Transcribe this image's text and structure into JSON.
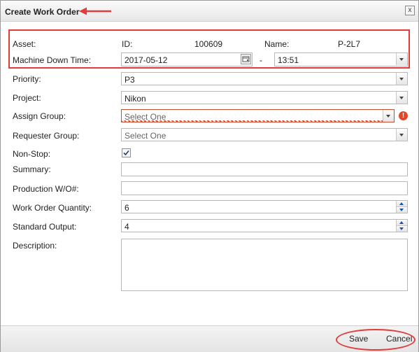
{
  "dialog": {
    "title": "Create Work Order",
    "close_label": "x"
  },
  "asset": {
    "label": "Asset:",
    "id_label": "ID:",
    "id_value": "100609",
    "name_label": "Name:",
    "name_value": "P-2L7"
  },
  "machine_down_time": {
    "label": "Machine Down Time:",
    "date": "2017-05-12",
    "separator": "-",
    "time": "13:51"
  },
  "priority": {
    "label": "Priority:",
    "value": "P3"
  },
  "project": {
    "label": "Project:",
    "value": "Nikon"
  },
  "assign_group": {
    "label": "Assign Group:",
    "placeholder": "Select One",
    "error_icon": "!"
  },
  "requester_group": {
    "label": "Requester Group:",
    "placeholder": "Select One"
  },
  "non_stop": {
    "label": "Non-Stop:",
    "checked": true
  },
  "summary": {
    "label": "Summary:",
    "value": ""
  },
  "production_wo": {
    "label": "Production W/O#:",
    "value": ""
  },
  "work_order_quantity": {
    "label": "Work Order Quantity:",
    "value": "6"
  },
  "standard_output": {
    "label": "Standard Output:",
    "value": "4"
  },
  "description": {
    "label": "Description:",
    "value": ""
  },
  "footer": {
    "save_label": "Save",
    "cancel_label": "Cancel"
  },
  "colors": {
    "annotation_red": "#e33b3b",
    "error_red": "#e4462b",
    "spinner_blue": "#1f4fa5"
  },
  "icons": {
    "close": "close-icon",
    "calendar": "calendar-icon",
    "dropdown": "chevron-down-icon",
    "error": "error-icon",
    "checkmark": "check-icon"
  }
}
